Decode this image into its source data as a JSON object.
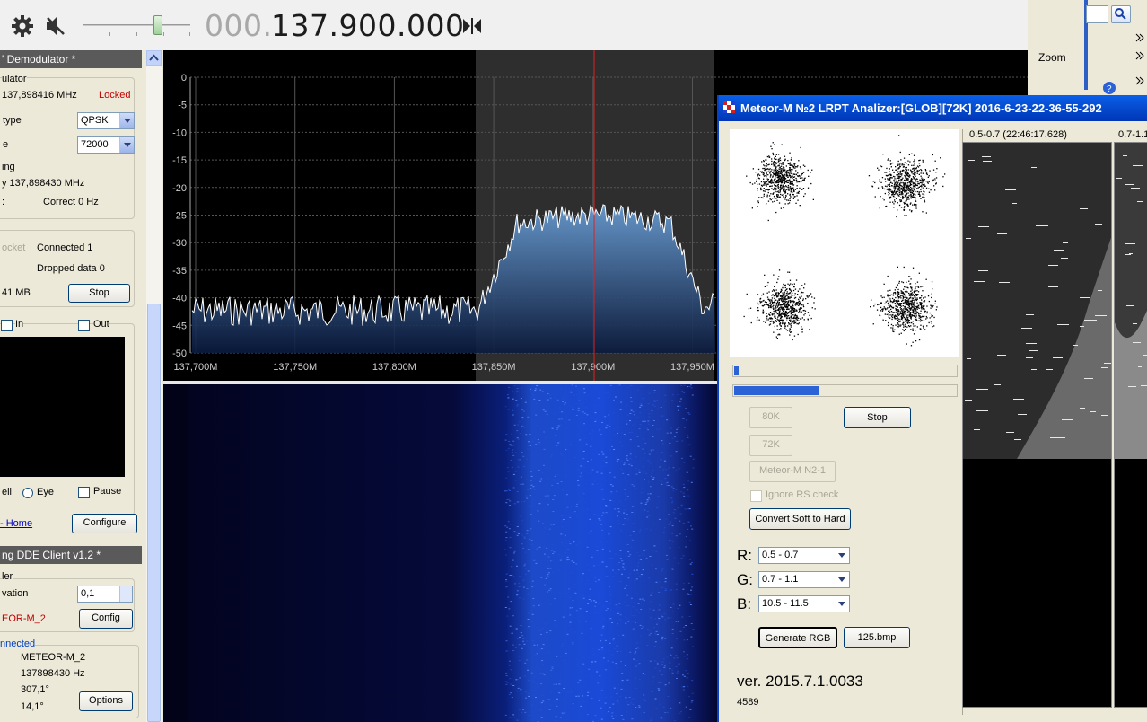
{
  "toolbar": {
    "frequency_dim": "000.",
    "frequency_main": "137.900.000",
    "icons": [
      "gear-icon",
      "mute-icon",
      "freq-step-icon"
    ],
    "volume_level": 0.7
  },
  "left_panel": {
    "demod": {
      "header": "' Demodulator *",
      "group_label": "ulator",
      "freq": "137,898416 MHz",
      "lock_status": "Locked",
      "type_label": "type",
      "type_value": "QPSK",
      "rate_label": "e",
      "rate_value": "72000",
      "tracking_label": "ing",
      "tracking_freq": "y 137,898430 MHz",
      "tracking_prefix": ":",
      "correct": "Correct 0 Hz",
      "socket_label": "ocket",
      "connected": "Connected 1",
      "dropped": "Dropped data 0",
      "mb": "41 MB",
      "stop_label": "Stop",
      "in_label": "In",
      "out_label": "Out",
      "ell_label": "ell",
      "eye_label": "Eye",
      "pause_label": "Pause",
      "home_link": "- Home",
      "configure_label": "Configure"
    },
    "dde": {
      "header": "ng DDE Client v1.2 *",
      "group_label": "ler",
      "elevation_label": "vation",
      "elevation_value": "0,1",
      "sat_label": "EOR-M_2",
      "config_label": "Config",
      "status": "nnected",
      "sat_name": "METEOR-M_2",
      "sat_freq": "137898430 Hz",
      "az": "307,1°",
      "el": "14,1°",
      "options_label": "Options"
    }
  },
  "spectrum": {
    "y_ticks": [
      "0",
      "-5",
      "-10",
      "-15",
      "-20",
      "-25",
      "-30",
      "-35",
      "-40",
      "-45",
      "-50"
    ],
    "x_ticks": [
      "137,700M",
      "137,750M",
      "137,800M",
      "137,850M",
      "137,900M",
      "137,950M"
    ]
  },
  "right_bg": {
    "zoom_label": "Zoom",
    "search_icon": "search-icon",
    "help_icon": "help-icon"
  },
  "meteor": {
    "title": "Meteor-M №2 LRPT Analizer:[GLOB][72K] 2016-6-23-22-36-55-292",
    "progress1": 0.02,
    "progress2": 0.38,
    "btn_80k": "80K",
    "btn_72k": "72K",
    "btn_stop": "Stop",
    "btn_meteor": "Meteor-M N2-1",
    "ignore_rs": "Ignore RS check",
    "convert": "Convert Soft to Hard",
    "r_label": "R:",
    "g_label": "G:",
    "b_label": "B:",
    "r_value": "0.5 - 0.7",
    "g_value": "0.7 - 1.1",
    "b_value": "10.5 - 11.5",
    "generate": "Generate RGB",
    "bmp": "125.bmp",
    "version": "ver. 2015.7.1.0033",
    "count": "4589"
  },
  "channels": {
    "ch1_label": "0.5-0.7 (22:46:17.628)",
    "ch2_label": "0.7-1.1"
  }
}
